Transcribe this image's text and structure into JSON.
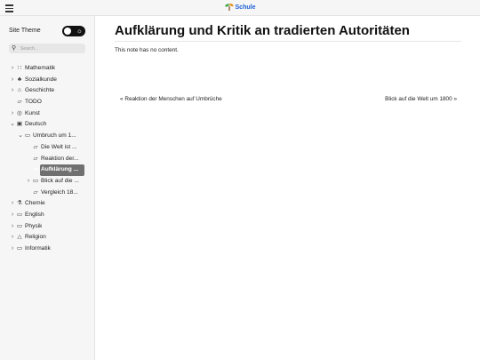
{
  "header": {
    "site_title": "Schule",
    "logo_icon": "sprout-icon",
    "menu_icon": "hamburger-icon"
  },
  "sidebar": {
    "theme_label": "Site Theme",
    "theme_toggle_icon": "sun-icon",
    "search_placeholder": "Search...",
    "items": [
      {
        "label": "Mathematik",
        "icon": "pi-icon",
        "chev": "›",
        "level": 0
      },
      {
        "label": "Sozialkunde",
        "icon": "people-icon",
        "chev": "›",
        "level": 0
      },
      {
        "label": "Geschichte",
        "icon": "museum-icon",
        "chev": "›",
        "level": 0
      },
      {
        "label": "TODO",
        "icon": "note-icon",
        "chev": "",
        "level": 0
      },
      {
        "label": "Kunst",
        "icon": "palette-icon",
        "chev": "›",
        "level": 0
      },
      {
        "label": "Deutsch",
        "icon": "book-icon",
        "chev": "⌄",
        "level": 0
      },
      {
        "label": "Umbruch um 1...",
        "icon": "folder-icon",
        "chev": "⌄",
        "level": 1
      },
      {
        "label": "Die Welt ist ...",
        "icon": "note-icon",
        "chev": "",
        "level": 2
      },
      {
        "label": "Reaktion der...",
        "icon": "note-icon",
        "chev": "",
        "level": 2
      },
      {
        "label": "Aufklärung ...",
        "icon": "note-icon",
        "chev": "",
        "level": 2,
        "active": true
      },
      {
        "label": "Blick auf die ...",
        "icon": "folder-icon",
        "chev": "›",
        "level": 2
      },
      {
        "label": "Vergleich 18...",
        "icon": "note-icon",
        "chev": "",
        "level": 2
      },
      {
        "label": "Chemie",
        "icon": "flask-icon",
        "chev": "›",
        "level": 0
      },
      {
        "label": "English",
        "icon": "folder-icon",
        "chev": "›",
        "level": 0
      },
      {
        "label": "Physik",
        "icon": "folder-icon",
        "chev": "›",
        "level": 0
      },
      {
        "label": "Religion",
        "icon": "triangle-icon",
        "chev": "›",
        "level": 0
      },
      {
        "label": "Informatik",
        "icon": "folder-icon",
        "chev": "›",
        "level": 0
      }
    ]
  },
  "main": {
    "title": "Aufklärung und Kritik an tradierten Autoritäten",
    "note": "This note has no content.",
    "prev_link": "« Reaktion der Menschen auf Umbrüche",
    "next_link": "Blick auf die Welt um 1800 »"
  },
  "colors": {
    "accent": "#1c5ed6",
    "sidebar_bg": "#f6f6f6",
    "active_bg": "#707070"
  }
}
